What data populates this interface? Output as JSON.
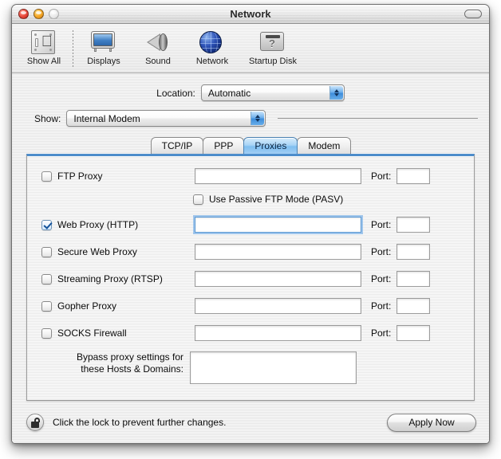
{
  "window": {
    "title": "Network",
    "controls": {
      "close": "close-button",
      "minimize": "minimize-button",
      "zoom": "zoom-button",
      "toolbar_toggle": "toolbar-toggle-button"
    }
  },
  "toolbar": {
    "items": [
      {
        "label": "Show All",
        "icon": "show-all-icon"
      },
      {
        "label": "Displays",
        "icon": "displays-icon"
      },
      {
        "label": "Sound",
        "icon": "sound-icon"
      },
      {
        "label": "Network",
        "icon": "network-globe-icon"
      },
      {
        "label": "Startup Disk",
        "icon": "startup-disk-icon"
      }
    ]
  },
  "location": {
    "label": "Location:",
    "value": "Automatic"
  },
  "show": {
    "label": "Show:",
    "value": "Internal Modem"
  },
  "tabs": [
    {
      "label": "TCP/IP",
      "active": false
    },
    {
      "label": "PPP",
      "active": false
    },
    {
      "label": "Proxies",
      "active": true
    },
    {
      "label": "Modem",
      "active": false
    }
  ],
  "proxies": {
    "port_label": "Port:",
    "rows": [
      {
        "label": "FTP Proxy",
        "checked": false,
        "host": "",
        "port": "",
        "focused": false
      },
      {
        "label": "Web Proxy (HTTP)",
        "checked": true,
        "host": "",
        "port": "",
        "focused": true
      },
      {
        "label": "Secure Web Proxy",
        "checked": false,
        "host": "",
        "port": "",
        "focused": false
      },
      {
        "label": "Streaming Proxy (RTSP)",
        "checked": false,
        "host": "",
        "port": "",
        "focused": false
      },
      {
        "label": "Gopher Proxy",
        "checked": false,
        "host": "",
        "port": "",
        "focused": false
      },
      {
        "label": "SOCKS Firewall",
        "checked": false,
        "host": "",
        "port": "",
        "focused": false
      }
    ],
    "passive": {
      "label": "Use Passive FTP Mode (PASV)",
      "checked": false
    },
    "bypass": {
      "label_line1": "Bypass proxy settings for",
      "label_line2": "these Hosts & Domains:",
      "value": ""
    }
  },
  "footer": {
    "lock_icon": "lock-open-icon",
    "lock_text": "Click the lock to prevent further changes.",
    "apply_label": "Apply Now"
  },
  "colors": {
    "accent_blue": "#4d8dcb",
    "tab_active": "#7fbef0",
    "focus_ring": "#6caae6",
    "check_mark": "#15539b"
  }
}
